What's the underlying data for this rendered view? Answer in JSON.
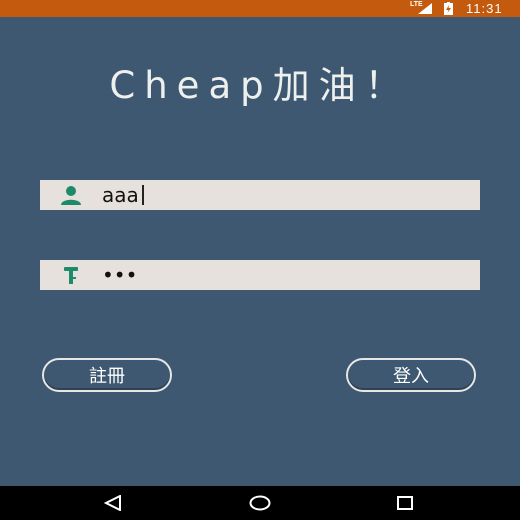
{
  "status_bar": {
    "network": "LTE",
    "time": "11:31"
  },
  "app_title": "Cheap加油！",
  "login_form": {
    "username_value": "aaa",
    "password_value": "•••",
    "username_icon": "person-icon",
    "password_icon": "key-icon"
  },
  "buttons": {
    "register_label": "註冊",
    "login_label": "登入"
  },
  "nav_bar": {
    "back_icon": "back-triangle-icon",
    "home_icon": "home-circle-icon",
    "recents_icon": "recents-square-icon"
  },
  "colors": {
    "status_bar": "#c45a0e",
    "background": "#3e5872",
    "field": "#e6e1dc",
    "icon_accent": "#1e8a6a"
  }
}
